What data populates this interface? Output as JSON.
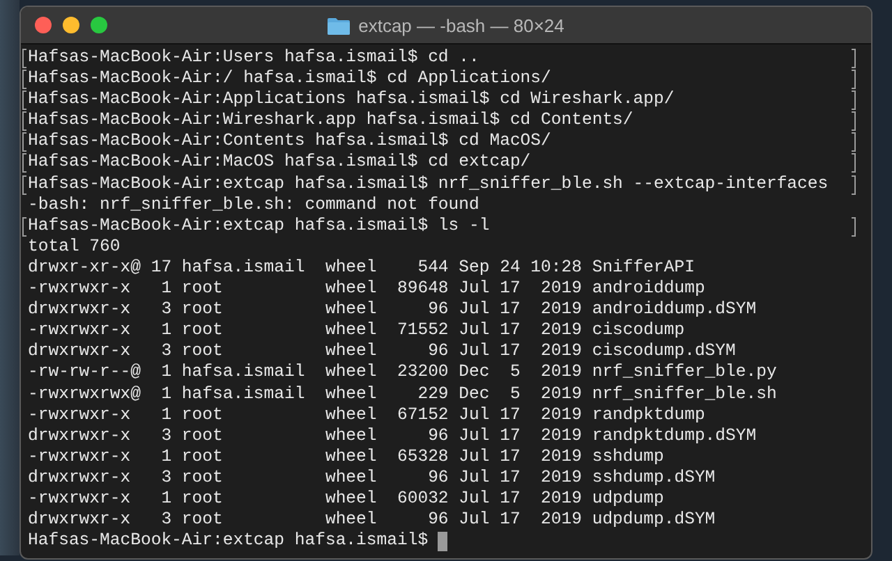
{
  "window": {
    "title": "extcap — -bash — 80×24"
  },
  "lines": [
    {
      "text": "Hafsas-MacBook-Air:Users hafsa.ismail$ cd ..",
      "marked": true,
      "cursor": false
    },
    {
      "text": "Hafsas-MacBook-Air:/ hafsa.ismail$ cd Applications/",
      "marked": true,
      "cursor": false
    },
    {
      "text": "Hafsas-MacBook-Air:Applications hafsa.ismail$ cd Wireshark.app/",
      "marked": true,
      "cursor": false
    },
    {
      "text": "Hafsas-MacBook-Air:Wireshark.app hafsa.ismail$ cd Contents/",
      "marked": true,
      "cursor": false
    },
    {
      "text": "Hafsas-MacBook-Air:Contents hafsa.ismail$ cd MacOS/",
      "marked": true,
      "cursor": false
    },
    {
      "text": "Hafsas-MacBook-Air:MacOS hafsa.ismail$ cd extcap/",
      "marked": true,
      "cursor": false
    },
    {
      "text": "Hafsas-MacBook-Air:extcap hafsa.ismail$ nrf_sniffer_ble.sh --extcap-interfaces",
      "marked": true,
      "cursor": false
    },
    {
      "text": "-bash: nrf_sniffer_ble.sh: command not found",
      "marked": false,
      "cursor": false
    },
    {
      "text": "Hafsas-MacBook-Air:extcap hafsa.ismail$ ls -l",
      "marked": true,
      "cursor": false
    },
    {
      "text": "total 760",
      "marked": false,
      "cursor": false
    },
    {
      "text": "drwxr-xr-x@ 17 hafsa.ismail  wheel    544 Sep 24 10:28 SnifferAPI",
      "marked": false,
      "cursor": false
    },
    {
      "text": "-rwxrwxr-x   1 root          wheel  89648 Jul 17  2019 androiddump",
      "marked": false,
      "cursor": false
    },
    {
      "text": "drwxrwxr-x   3 root          wheel     96 Jul 17  2019 androiddump.dSYM",
      "marked": false,
      "cursor": false
    },
    {
      "text": "-rwxrwxr-x   1 root          wheel  71552 Jul 17  2019 ciscodump",
      "marked": false,
      "cursor": false
    },
    {
      "text": "drwxrwxr-x   3 root          wheel     96 Jul 17  2019 ciscodump.dSYM",
      "marked": false,
      "cursor": false
    },
    {
      "text": "-rw-rw-r--@  1 hafsa.ismail  wheel  23200 Dec  5  2019 nrf_sniffer_ble.py",
      "marked": false,
      "cursor": false
    },
    {
      "text": "-rwxrwxrwx@  1 hafsa.ismail  wheel    229 Dec  5  2019 nrf_sniffer_ble.sh",
      "marked": false,
      "cursor": false
    },
    {
      "text": "-rwxrwxr-x   1 root          wheel  67152 Jul 17  2019 randpktdump",
      "marked": false,
      "cursor": false
    },
    {
      "text": "drwxrwxr-x   3 root          wheel     96 Jul 17  2019 randpktdump.dSYM",
      "marked": false,
      "cursor": false
    },
    {
      "text": "-rwxrwxr-x   1 root          wheel  65328 Jul 17  2019 sshdump",
      "marked": false,
      "cursor": false
    },
    {
      "text": "drwxrwxr-x   3 root          wheel     96 Jul 17  2019 sshdump.dSYM",
      "marked": false,
      "cursor": false
    },
    {
      "text": "-rwxrwxr-x   1 root          wheel  60032 Jul 17  2019 udpdump",
      "marked": false,
      "cursor": false
    },
    {
      "text": "drwxrwxr-x   3 root          wheel     96 Jul 17  2019 udpdump.dSYM",
      "marked": false,
      "cursor": false
    },
    {
      "text": "Hafsas-MacBook-Air:extcap hafsa.ismail$ ",
      "marked": false,
      "cursor": true
    }
  ]
}
